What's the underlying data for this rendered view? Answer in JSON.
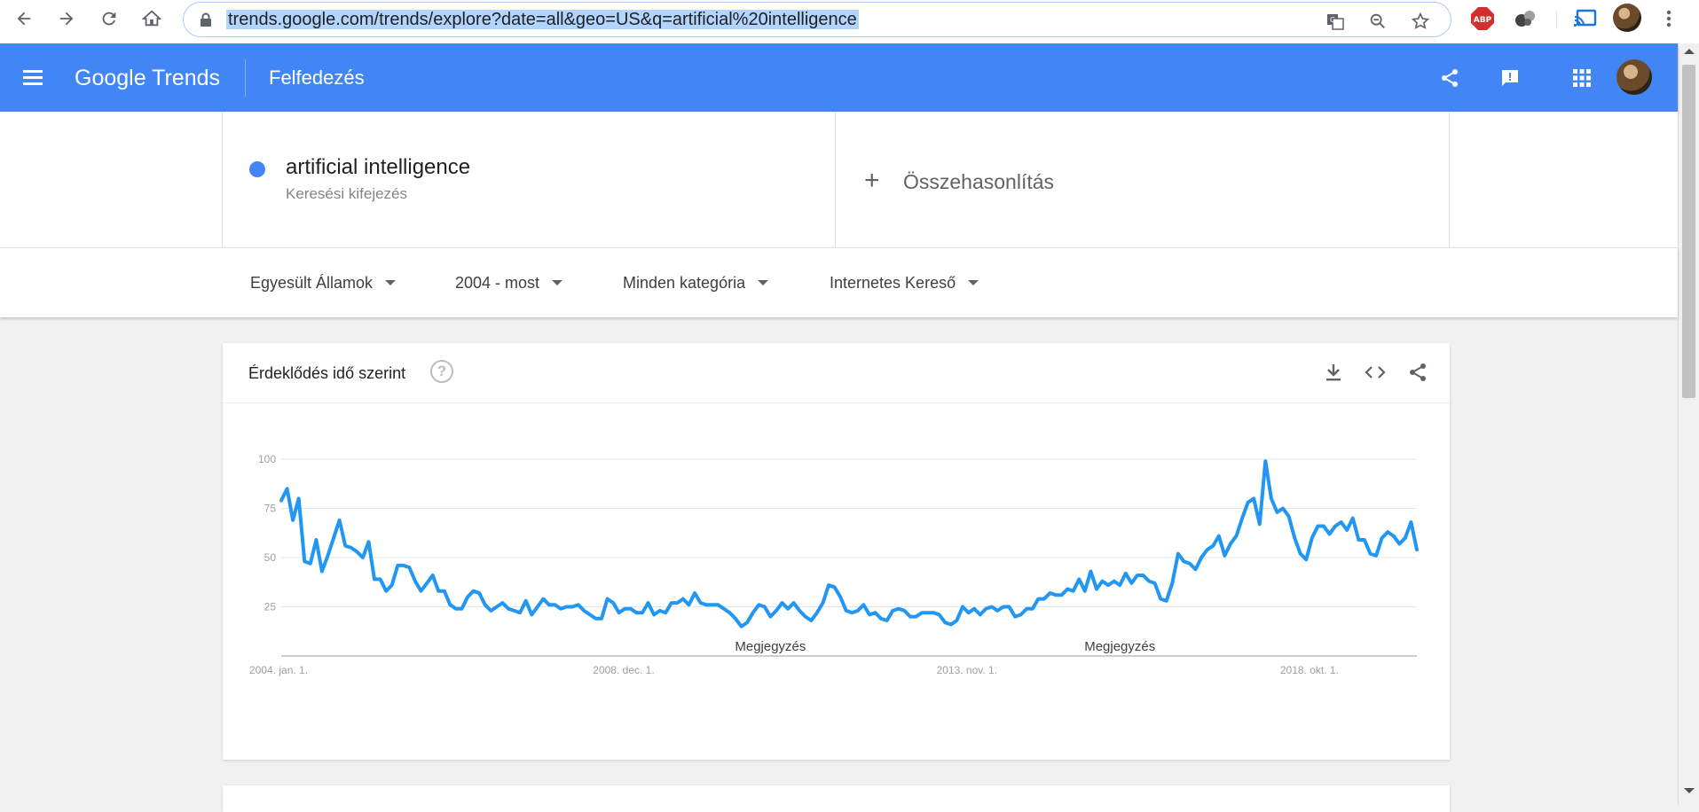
{
  "browser": {
    "url": "trends.google.com/trends/explore?date=all&geo=US&q=artificial%20intelligence",
    "adblock_label": "ABP"
  },
  "header": {
    "brand_google": "Google",
    "brand_trends": "Trends",
    "page_title": "Felfedezés"
  },
  "search_terms": {
    "term": "artificial intelligence",
    "term_type": "Keresési kifejezés",
    "term_color": "#4285f4",
    "compare_plus": "+",
    "compare_label": "Összehasonlítás"
  },
  "filters": {
    "region": "Egyesült Államok",
    "period": "2004 - most",
    "category": "Minden kategória",
    "search_type": "Internetes Kereső"
  },
  "chart_card": {
    "title": "Érdeklődés idő szerint",
    "help": "?"
  },
  "chart_data": {
    "type": "line",
    "series_color": "#2196f3",
    "ylim": [
      0,
      100
    ],
    "yticks": [
      25,
      50,
      75,
      100
    ],
    "x_tick_labels": [
      "2004. jan. 1.",
      "2008. dec. 1.",
      "2013. nov. 1.",
      "2018. okt. 1."
    ],
    "x_tick_months": [
      0,
      59,
      118,
      177
    ],
    "annotations": [
      {
        "month": 84,
        "label": "Megjegyzés"
      },
      {
        "month": 144,
        "label": "Megjegyzés"
      }
    ],
    "series": [
      {
        "values": [
          79,
          85,
          69,
          80,
          48,
          47,
          59,
          43,
          51,
          60,
          69,
          56,
          55,
          53,
          50,
          58,
          39,
          39,
          33,
          36,
          46,
          46,
          45,
          38,
          33,
          37,
          41,
          33,
          33,
          26,
          24,
          24,
          30,
          33,
          32,
          26,
          23,
          25,
          27,
          24,
          23,
          22,
          28,
          21,
          25,
          29,
          26,
          26,
          24,
          25,
          25,
          26,
          23,
          21,
          19,
          19,
          29,
          27,
          22,
          24,
          24,
          22,
          22,
          27,
          21,
          23,
          22,
          27,
          27,
          29,
          26,
          32,
          27,
          26,
          26,
          26,
          24,
          22,
          19,
          15,
          17,
          22,
          26,
          25,
          20,
          23,
          27,
          24,
          27,
          23,
          20,
          18,
          22,
          27,
          36,
          35,
          30,
          23,
          22,
          23,
          26,
          21,
          22,
          19,
          18,
          23,
          24,
          23,
          20,
          20,
          22,
          22,
          22,
          21,
          17,
          16,
          18,
          25,
          22,
          24,
          21,
          24,
          25,
          23,
          25,
          25,
          20,
          21,
          24,
          24,
          29,
          29,
          32,
          31,
          31,
          34,
          33,
          39,
          33,
          43,
          34,
          38,
          36,
          38,
          36,
          42,
          37,
          41,
          41,
          38,
          37,
          29,
          28,
          37,
          52,
          48,
          47,
          44,
          50,
          54,
          56,
          61,
          51,
          57,
          61,
          70,
          78,
          80,
          67,
          99,
          80,
          73,
          75,
          71,
          60,
          52,
          49,
          60,
          66,
          66,
          62,
          66,
          68,
          64,
          70,
          59,
          59,
          52,
          51,
          60,
          63,
          61,
          57,
          60,
          68,
          54
        ]
      }
    ]
  }
}
